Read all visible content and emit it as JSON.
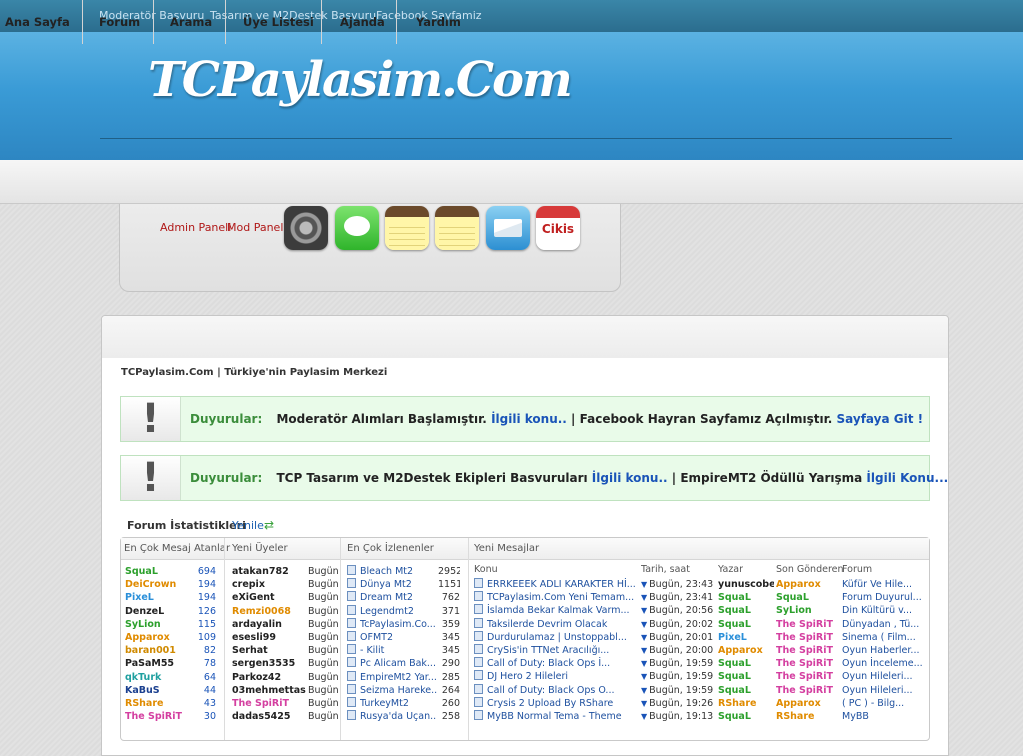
{
  "topbar": {
    "links": [
      "Moderatör Basvuru",
      "Tasarım ve M2Destek Basvuru",
      "Facebook Sayfamiz"
    ]
  },
  "header": {
    "logo_text": "TCPaylasim.Com"
  },
  "nav": {
    "items": [
      "Ana Sayfa",
      "Forum",
      "Arama",
      "Üye Listesi",
      "Ajanda",
      "Yardım"
    ]
  },
  "admin": {
    "admin_panel": "Admin Paneli",
    "mod_panel": "Mod Paneli",
    "icons": [
      "settings-icon",
      "message-icon",
      "notes-icon",
      "notes-icon",
      "mail-icon",
      "exit-icon"
    ],
    "exit_label": "Cikis"
  },
  "site_title": "TCPaylasim.Com | Türkiye'nin Paylasim Merkezi",
  "announcements": [
    {
      "label": "Duyurular:",
      "text1": "Moderatör Alımları Başlamıştır.",
      "link1": "İlgili konu..",
      "sep": "|",
      "text2": "Facebook Hayran Sayfamız Açılmıştır.",
      "link2": "Sayfaya Git !"
    },
    {
      "label": "Duyurular:",
      "text1": "TCP Tasarım ve M2Destek Ekipleri Basvuruları",
      "link1": "İlgili konu..",
      "sep": "|",
      "text2": "EmpireMT2 Ödüllü Yarışma",
      "link2": "İlgili Konu..."
    }
  ],
  "stats": {
    "heading": "Forum İstatistikleri",
    "refresh": "Yenile",
    "headers": {
      "top_posters": "En Çok Mesaj Atanlar",
      "new_members": "Yeni Üyeler",
      "most_viewed": "En Çok İzlenenler",
      "new_posts": "Yeni Mesajlar",
      "topic": "Konu",
      "datetime": "Tarih, saat",
      "author": "Yazar",
      "last_sender": "Son Gönderen",
      "forum": "Forum"
    },
    "top_posters": [
      {
        "name": "SquaL",
        "count": "694",
        "color": "#2ca02c"
      },
      {
        "name": "DeiCrown",
        "count": "194",
        "color": "#e08b00"
      },
      {
        "name": "PixeL",
        "count": "194",
        "color": "#2a8fd9"
      },
      {
        "name": "DenzeL",
        "count": "126",
        "color": "#222222"
      },
      {
        "name": "SyLion",
        "count": "115",
        "color": "#2ca02c"
      },
      {
        "name": "Apparox",
        "count": "109",
        "color": "#e08b00"
      },
      {
        "name": "baran001",
        "count": "82",
        "color": "#d08a00"
      },
      {
        "name": "PaSaM55",
        "count": "78",
        "color": "#222222"
      },
      {
        "name": "qkTurk",
        "count": "64",
        "color": "#20a0a0"
      },
      {
        "name": "KaBuS",
        "count": "44",
        "color": "#1a3f8f"
      },
      {
        "name": "RShare",
        "count": "43",
        "color": "#e08b00"
      },
      {
        "name": "The SpiRiT",
        "count": "30",
        "color": "#d43fa0"
      }
    ],
    "new_members": [
      {
        "name": "atakan782",
        "when": "Bugün",
        "color": "#222222"
      },
      {
        "name": "crepix",
        "when": "Bugün",
        "color": "#222222"
      },
      {
        "name": "eXiGent",
        "when": "Bugün",
        "color": "#222222"
      },
      {
        "name": "Remzi0068",
        "when": "Bugün",
        "color": "#e08b00"
      },
      {
        "name": "ardayalin",
        "when": "Bugün",
        "color": "#222222"
      },
      {
        "name": "esesli99",
        "when": "Bugün",
        "color": "#222222"
      },
      {
        "name": "Serhat",
        "when": "Bugün",
        "color": "#222222"
      },
      {
        "name": "sergen3535",
        "when": "Bugün",
        "color": "#222222"
      },
      {
        "name": "Parkoz42",
        "when": "Bugün",
        "color": "#222222"
      },
      {
        "name": "03mehmettas",
        "when": "Bugün",
        "color": "#222222"
      },
      {
        "name": "The SpiRiT",
        "when": "Bugün",
        "color": "#d43fa0"
      },
      {
        "name": "dadas5425",
        "when": "Bugün",
        "color": "#222222"
      }
    ],
    "most_viewed": [
      {
        "title": "Bleach Mt2",
        "views": "2952"
      },
      {
        "title": "Dünya Mt2",
        "views": "1151"
      },
      {
        "title": "Dream Mt2",
        "views": "762"
      },
      {
        "title": "Legendmt2",
        "views": "371"
      },
      {
        "title": "TcPaylasim.Co...",
        "views": "359"
      },
      {
        "title": "OFMT2",
        "views": "345"
      },
      {
        "title": "- Kilit",
        "views": "345"
      },
      {
        "title": "Pc Alicam Bak...",
        "views": "290"
      },
      {
        "title": "EmpireMt2 Yar...",
        "views": "285"
      },
      {
        "title": "Seizma Hareke...",
        "views": "264"
      },
      {
        "title": "TurkeyMt2",
        "views": "260"
      },
      {
        "title": "Rusya'da Uçan...",
        "views": "258"
      }
    ],
    "new_posts": [
      {
        "topic": "ERRKEEEK ADLI KARAKTER Hİ...",
        "date": "Bugün, 23:43",
        "author": "yunuscobe",
        "author_color": "#222222",
        "last": "Apparox",
        "last_color": "#e08b00",
        "forum": "Küfür Ve Hile..."
      },
      {
        "topic": "TCPaylasim.Com Yeni Temam...",
        "date": "Bugün, 23:41",
        "author": "SquaL",
        "author_color": "#2ca02c",
        "last": "SquaL",
        "last_color": "#2ca02c",
        "forum": "Forum Duyurul..."
      },
      {
        "topic": "İslamda Bekar Kalmak Varm...",
        "date": "Bugün, 20:56",
        "author": "SquaL",
        "author_color": "#2ca02c",
        "last": "SyLion",
        "last_color": "#2ca02c",
        "forum": "Din Kültürü v..."
      },
      {
        "topic": "Taksilerde Devrim Olacak",
        "date": "Bugün, 20:02",
        "author": "SquaL",
        "author_color": "#2ca02c",
        "last": "The SpiRiT",
        "last_color": "#d43fa0",
        "forum": "Dünyadan , Tü..."
      },
      {
        "topic": "Durdurulamaz | Unstoppabl...",
        "date": "Bugün, 20:01",
        "author": "PixeL",
        "author_color": "#2a8fd9",
        "last": "The SpiRiT",
        "last_color": "#d43fa0",
        "forum": "Sinema ( Film..."
      },
      {
        "topic": "CrySis'in TTNet Aracılığı...",
        "date": "Bugün, 20:00",
        "author": "Apparox",
        "author_color": "#e08b00",
        "last": "The SpiRiT",
        "last_color": "#d43fa0",
        "forum": "Oyun Haberler..."
      },
      {
        "topic": "Call of Duty: Black Ops İ...",
        "date": "Bugün, 19:59",
        "author": "SquaL",
        "author_color": "#2ca02c",
        "last": "The SpiRiT",
        "last_color": "#d43fa0",
        "forum": "Oyun İnceleme..."
      },
      {
        "topic": "DJ Hero 2 Hileleri",
        "date": "Bugün, 19:59",
        "author": "SquaL",
        "author_color": "#2ca02c",
        "last": "The SpiRiT",
        "last_color": "#d43fa0",
        "forum": "Oyun Hileleri..."
      },
      {
        "topic": "Call of Duty: Black Ops O...",
        "date": "Bugün, 19:59",
        "author": "SquaL",
        "author_color": "#2ca02c",
        "last": "The SpiRiT",
        "last_color": "#d43fa0",
        "forum": "Oyun Hileleri..."
      },
      {
        "topic": "Crysis 2 Upload By RShare",
        "date": "Bugün, 19:26",
        "author": "RShare",
        "author_color": "#e08b00",
        "last": "Apparox",
        "last_color": "#e08b00",
        "forum": "( PC ) - Bilg..."
      },
      {
        "topic": "MyBB Normal Tema - Theme",
        "date": "Bugün, 19:13",
        "author": "SquaL",
        "author_color": "#2ca02c",
        "last": "RShare",
        "last_color": "#e08b00",
        "forum": "MyBB"
      }
    ]
  },
  "colors": {
    "topbar": "#2f6f8e",
    "header": "#3a9bd6",
    "announcement_bg": "#e9fbe9",
    "link": "#1a54b8"
  }
}
